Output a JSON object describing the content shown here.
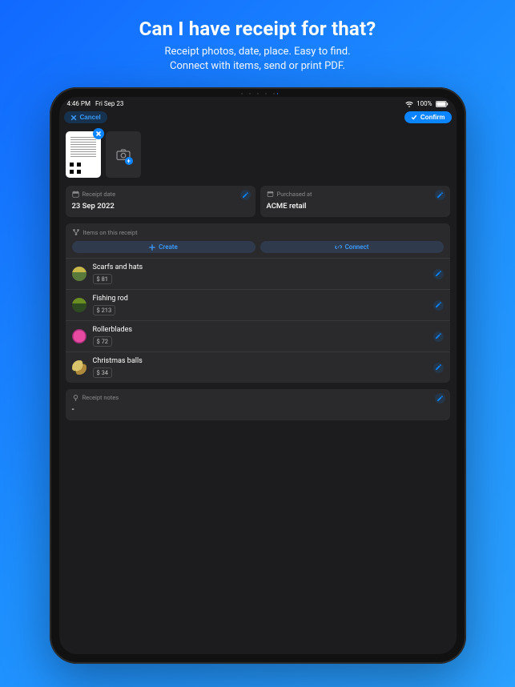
{
  "promo": {
    "title": "Can I have receipt for that?",
    "subtitle_line1": "Receipt photos, date, place. Easy to find.",
    "subtitle_line2": "Connect with items, send or print PDF."
  },
  "status": {
    "time": "4:46 PM",
    "date": "Fri Sep 23",
    "battery_pct": "100%"
  },
  "nav": {
    "cancel_label": "Cancel",
    "confirm_label": "Confirm"
  },
  "fields": {
    "date_label": "Receipt date",
    "date_value": "23 Sep 2022",
    "place_label": "Purchased at",
    "place_value": "ACME retail"
  },
  "items_section": {
    "label": "Items on this receipt",
    "create_label": "Create",
    "connect_label": "Connect"
  },
  "items": [
    {
      "name": "Scarfs and hats",
      "price": "$ 81"
    },
    {
      "name": "Fishing rod",
      "price": "$ 213"
    },
    {
      "name": "Rollerblades",
      "price": "$ 72"
    },
    {
      "name": "Christmas balls",
      "price": "$ 34"
    }
  ],
  "notes": {
    "label": "Receipt notes",
    "value": "-"
  }
}
